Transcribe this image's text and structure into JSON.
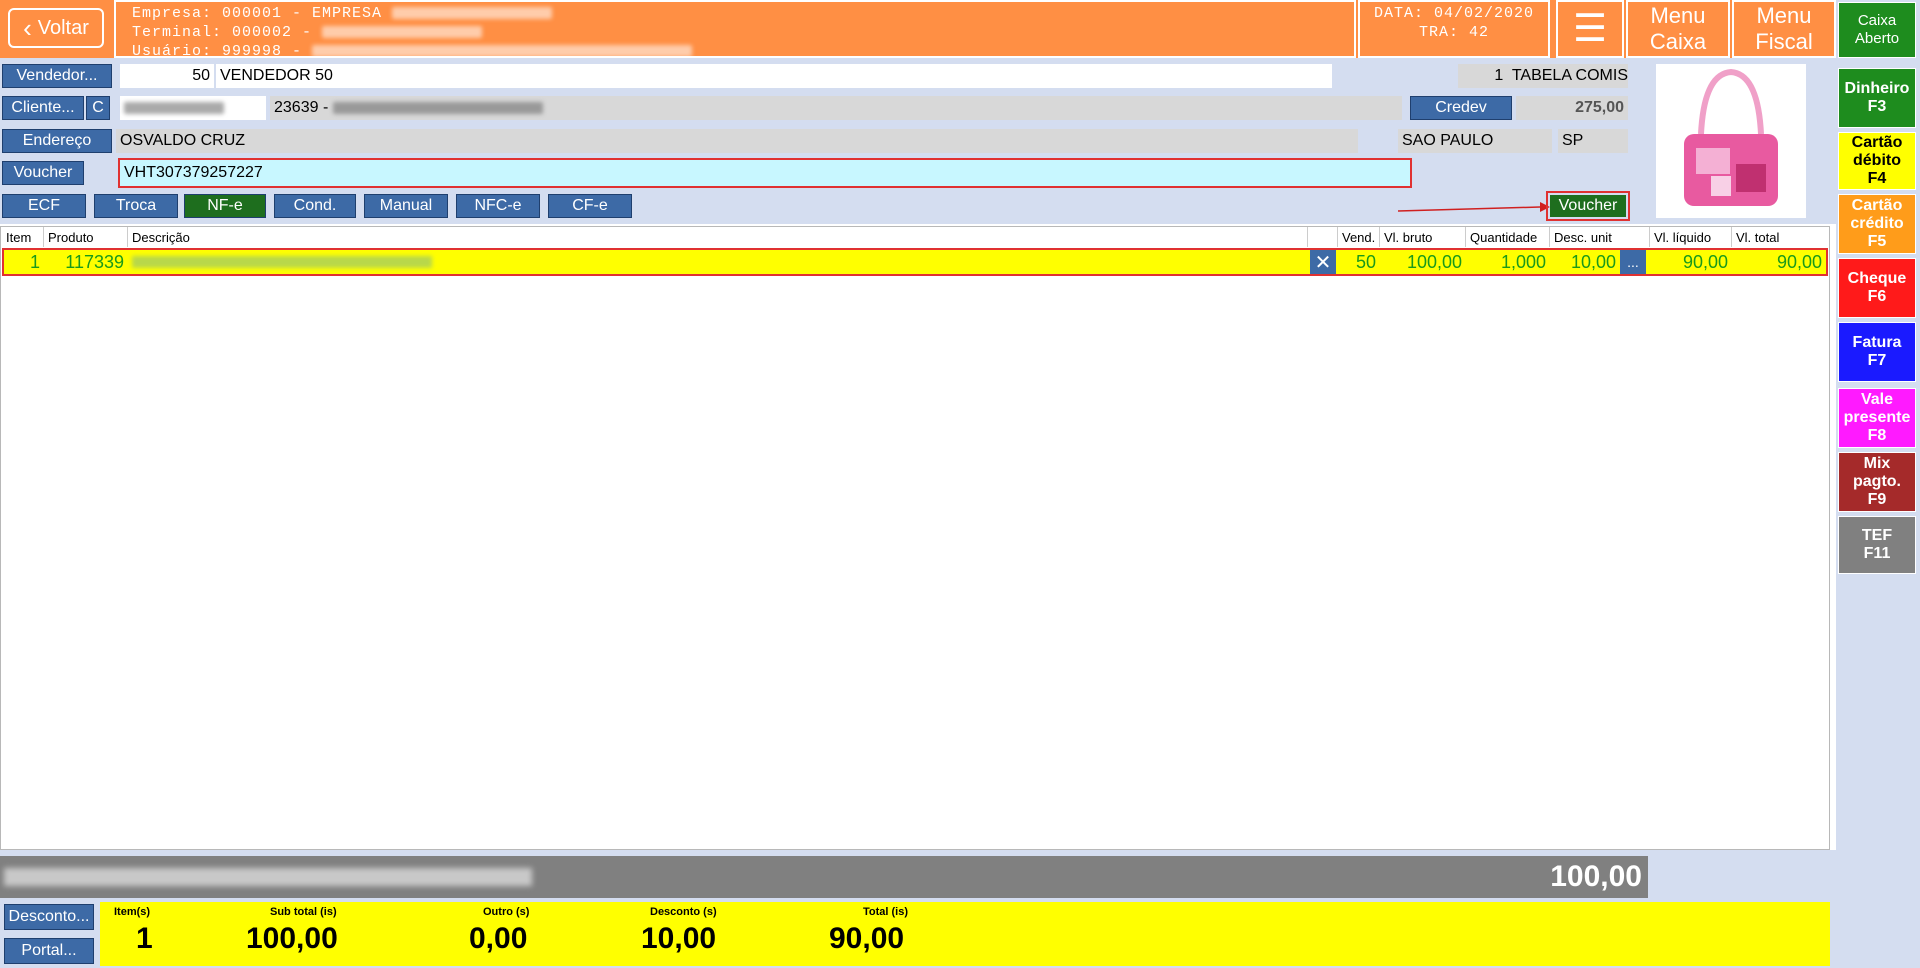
{
  "header": {
    "back_label": "Voltar",
    "empresa": "Empresa: 000001 - EMPRESA",
    "terminal": "Terminal: 000002 -",
    "usuario": "Usuário: 999998 -",
    "data": "DATA: 04/02/2020",
    "tra": "TRA: 42",
    "menu_caixa": "Menu Caixa",
    "menu_fiscal": "Menu Fiscal",
    "caixa_status": "Caixa Aberto"
  },
  "colors": {
    "header": "#ff8f44",
    "form_bg": "#d4ddf0",
    "button_blue": "#3d6aa6",
    "highlight": "#ffff00",
    "row_text": "#1a9a1a"
  },
  "payments": [
    {
      "label": "Dinheiro",
      "key": "F3",
      "bg": "#1e8c1e",
      "fg": "#ffffff"
    },
    {
      "label": "Cartão débito",
      "key": "F4",
      "bg": "#ffff00",
      "fg": "#000000"
    },
    {
      "label": "Cartão crédito",
      "key": "F5",
      "bg": "#ff9c1a",
      "fg": "#ffffff"
    },
    {
      "label": "Cheque",
      "key": "F6",
      "bg": "#ff1a1a",
      "fg": "#ffffff"
    },
    {
      "label": "Fatura",
      "key": "F7",
      "bg": "#1a1aff",
      "fg": "#ffffff"
    },
    {
      "label": "Vale presente",
      "key": "F8",
      "bg": "#ff1aff",
      "fg": "#ffffff"
    },
    {
      "label": "Mix pagto.",
      "key": "F9",
      "bg": "#a52a2a",
      "fg": "#ffffff"
    },
    {
      "label": "TEF",
      "key": "F11",
      "bg": "#808080",
      "fg": "#ffffff"
    }
  ],
  "form": {
    "vendedor_label": "Vendedor...",
    "vendedor_code": "50",
    "vendedor_name": "VENDEDOR 50",
    "tabela": "1  TABELA COMIS",
    "cliente_label": "Cliente...",
    "cliente_c": "C",
    "cliente_code": "23639 -",
    "credev_label": "Credev",
    "credev_value": "275,00",
    "endereco_label": "Endereço",
    "endereco": "OSVALDO CRUZ",
    "cidade": "SAO PAULO",
    "uf": "SP",
    "voucher_label": "Voucher",
    "voucher_value": "VHT307379257227",
    "voucher_button": "Voucher"
  },
  "doc_buttons": [
    "ECF",
    "Troca",
    "NF-e",
    "Cond.",
    "Manual",
    "NFC-e",
    "CF-e"
  ],
  "grid": {
    "columns": [
      "Item",
      "Produto",
      "Descrição",
      "Vend.",
      "Vl. bruto",
      "Quantidade",
      "Desc. unit",
      "Vl. líquido",
      "Vl. total"
    ],
    "rows": [
      {
        "item": "1",
        "produto": "117339",
        "vend": "50",
        "vl_bruto": "100,00",
        "quantidade": "1,000",
        "desc_unit": "10,00",
        "vl_liquido": "90,00",
        "vl_total": "90,00"
      }
    ]
  },
  "footer": {
    "bar_total": "100,00",
    "desconto_label": "Desconto...",
    "portal_label": "Portal...",
    "totals": [
      {
        "label": "Item(s)",
        "value": "1"
      },
      {
        "label": "Sub total (is)",
        "value": "100,00"
      },
      {
        "label": "Outro (s)",
        "value": "0,00"
      },
      {
        "label": "Desconto (s)",
        "value": "10,00"
      },
      {
        "label": "Total (is)",
        "value": "90,00"
      }
    ]
  }
}
